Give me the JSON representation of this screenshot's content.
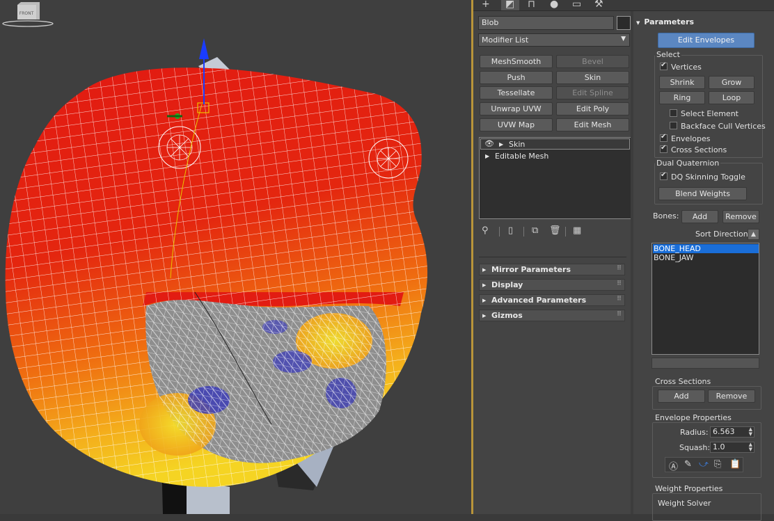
{
  "viewport": {
    "viewcube_label": "FRONT",
    "colors": {
      "background": "#3f3f3f",
      "red": "#e01a12",
      "orange": "#f07a10",
      "yellow": "#f5d21e",
      "grey": "#8f8f8f",
      "blue": "#3c3cb4"
    }
  },
  "command_panel": {
    "tabs": [
      "create-tab",
      "modify-tab",
      "hierarchy-tab",
      "motion-tab",
      "display-tab",
      "utilities-tab"
    ],
    "object_name": "Blob",
    "modifier_list_label": "Modifier List",
    "modifier_buttons": [
      {
        "label": "MeshSmooth",
        "enabled": true
      },
      {
        "label": "Bevel",
        "enabled": false
      },
      {
        "label": "Push",
        "enabled": true
      },
      {
        "label": "Skin",
        "enabled": true
      },
      {
        "label": "Tessellate",
        "enabled": true
      },
      {
        "label": "Edit Spline",
        "enabled": false
      },
      {
        "label": "Unwrap UVW",
        "enabled": true
      },
      {
        "label": "Edit Poly",
        "enabled": true
      },
      {
        "label": "UVW Map",
        "enabled": true
      },
      {
        "label": "Edit Mesh",
        "enabled": true
      }
    ],
    "stack": [
      {
        "label": "Skin",
        "selected": true
      },
      {
        "label": "Editable Mesh",
        "selected": false
      }
    ],
    "rollouts": [
      "Mirror Parameters",
      "Display",
      "Advanced Parameters",
      "Gizmos"
    ]
  },
  "parameters": {
    "title": "Parameters",
    "edit_envelopes": "Edit Envelopes",
    "select": {
      "title": "Select",
      "vertices": "Vertices",
      "shrink": "Shrink",
      "grow": "Grow",
      "ring": "Ring",
      "loop": "Loop",
      "select_element": "Select Element",
      "backface_cull": "Backface Cull Vertices",
      "envelopes": "Envelopes",
      "cross_sections": "Cross Sections"
    },
    "dual_quaternion": {
      "title": "Dual Quaternion",
      "dq_toggle": "DQ Skinning Toggle",
      "blend_weights": "Blend Weights"
    },
    "bones_label": "Bones:",
    "bones_add": "Add",
    "bones_remove": "Remove",
    "sort_direction": "Sort Direction:",
    "bones": [
      "BONE_HEAD",
      "BONE_JAW"
    ],
    "cross_sections": {
      "title": "Cross Sections",
      "add": "Add",
      "remove": "Remove"
    },
    "envelope_properties": {
      "title": "Envelope Properties",
      "radius_label": "Radius:",
      "radius_value": "6.563",
      "squash_label": "Squash:",
      "squash_value": "1.0"
    },
    "weight_properties": {
      "title": "Weight Properties",
      "weight_solver": "Weight Solver"
    }
  }
}
